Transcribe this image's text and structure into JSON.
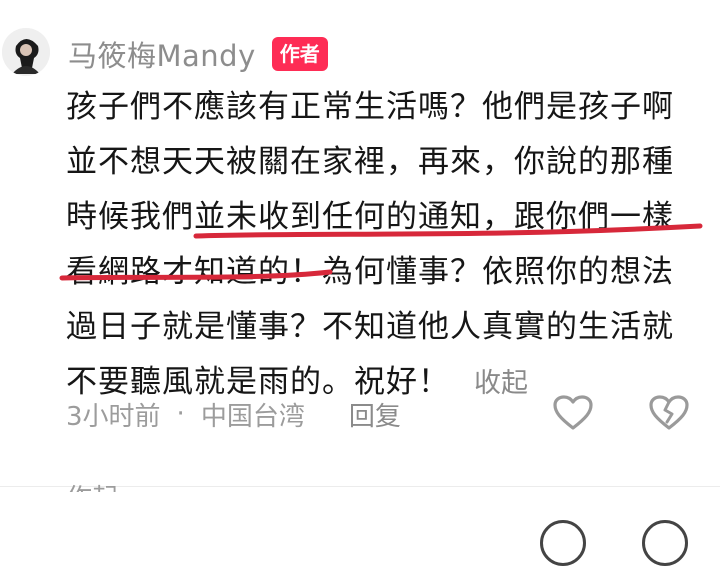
{
  "comment": {
    "username": "马筱梅Mandy",
    "author_badge": "作者",
    "lines": [
      "孩子們不應該有正常生活嗎？他們是孩子啊",
      "並不想天天被關在家裡，再來，你說的那種",
      "時候我們並未收到任何的通知，跟你們一樣",
      "看網路才知道的！為何懂事？依照你的想法",
      "過日子就是懂事？不知道他人真實的生活就",
      "不要聽風就是雨的。祝好！"
    ],
    "collapse_label": "收起",
    "time": "3小时前",
    "separator": "·",
    "location": "中国台湾",
    "reply_label": "回复"
  },
  "next_comment_preview": "作起",
  "colors": {
    "author_badge": "#fe2c55",
    "underline": "#d7283a",
    "meta_text": "#9c9c9c"
  },
  "icons": [
    "heart-icon",
    "broken-heart-icon"
  ]
}
